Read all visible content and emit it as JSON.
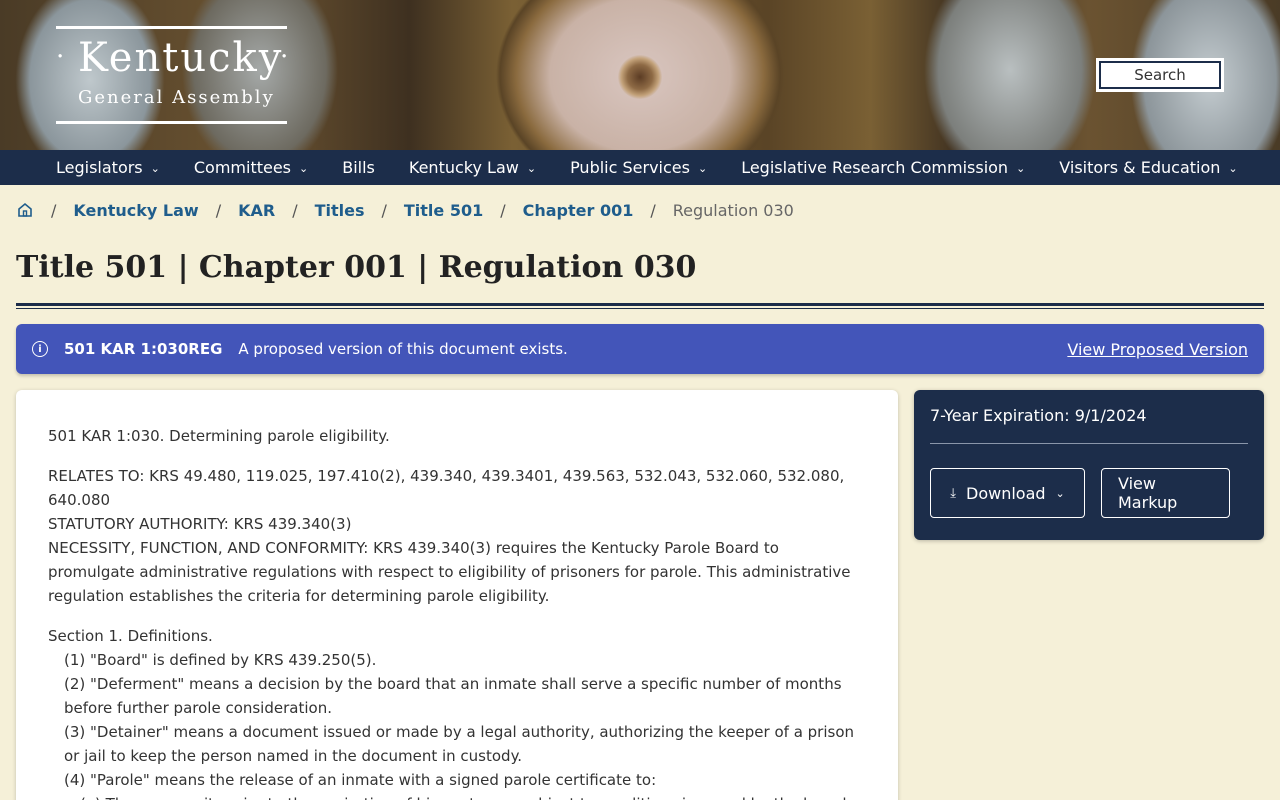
{
  "header": {
    "logo_title": "Kentucky",
    "logo_subtitle": "General Assembly",
    "search_label": "Search"
  },
  "nav": {
    "items": [
      {
        "label": "Legislators",
        "dropdown": true
      },
      {
        "label": "Committees",
        "dropdown": true
      },
      {
        "label": "Bills",
        "dropdown": false
      },
      {
        "label": "Kentucky Law",
        "dropdown": true
      },
      {
        "label": "Public Services",
        "dropdown": true
      },
      {
        "label": "Legislative Research Commission",
        "dropdown": true
      },
      {
        "label": "Visitors & Education",
        "dropdown": true
      }
    ]
  },
  "breadcrumb": {
    "items": [
      "Kentucky Law",
      "KAR",
      "Titles",
      "Title 501",
      "Chapter 001"
    ],
    "current": "Regulation 030"
  },
  "page": {
    "title": "Title 501 | Chapter 001 | Regulation 030"
  },
  "alert": {
    "code": "501 KAR 1:030REG",
    "message": "A proposed version of this document exists.",
    "link": "View Proposed Version"
  },
  "document": {
    "heading": "501 KAR 1:030.  Determining parole eligibility.",
    "relates_to": "RELATES TO:  KRS 49.480, 119.025, 197.410(2), 439.340, 439.3401, 439.563, 532.043, 532.060, 532.080, 640.080",
    "statutory_authority": "STATUTORY AUTHORITY:  KRS 439.340(3)",
    "necessity": "NECESSITY, FUNCTION, AND CONFORMITY:  KRS 439.340(3) requires the Kentucky Parole Board to promulgate administrative regulations with respect to eligibility of prisoners for parole. This administrative regulation establishes the criteria for determining parole eligibility.",
    "section1": "Section 1.  Definitions.",
    "def1": "(1)  \"Board\" is defined by KRS 439.250(5).",
    "def2": "(2)  \"Deferment\" means a decision by the board that an inmate shall serve a specific number of months before further parole consideration.",
    "def3": "(3)  \"Detainer\" means a document issued or made by a legal authority, authorizing the keeper of a prison or jail to keep the person named in the document in custody.",
    "def4": "(4)  \"Parole\" means the release of an inmate with a signed parole certificate to:",
    "def4a": "(a)  The community prior to the expiration of his sentence, subject to conditions imposed by the board and subject to its supervision; or"
  },
  "side": {
    "expiration": "7-Year Expiration: 9/1/2024",
    "download_label": "Download",
    "markup_label": "View Markup"
  }
}
